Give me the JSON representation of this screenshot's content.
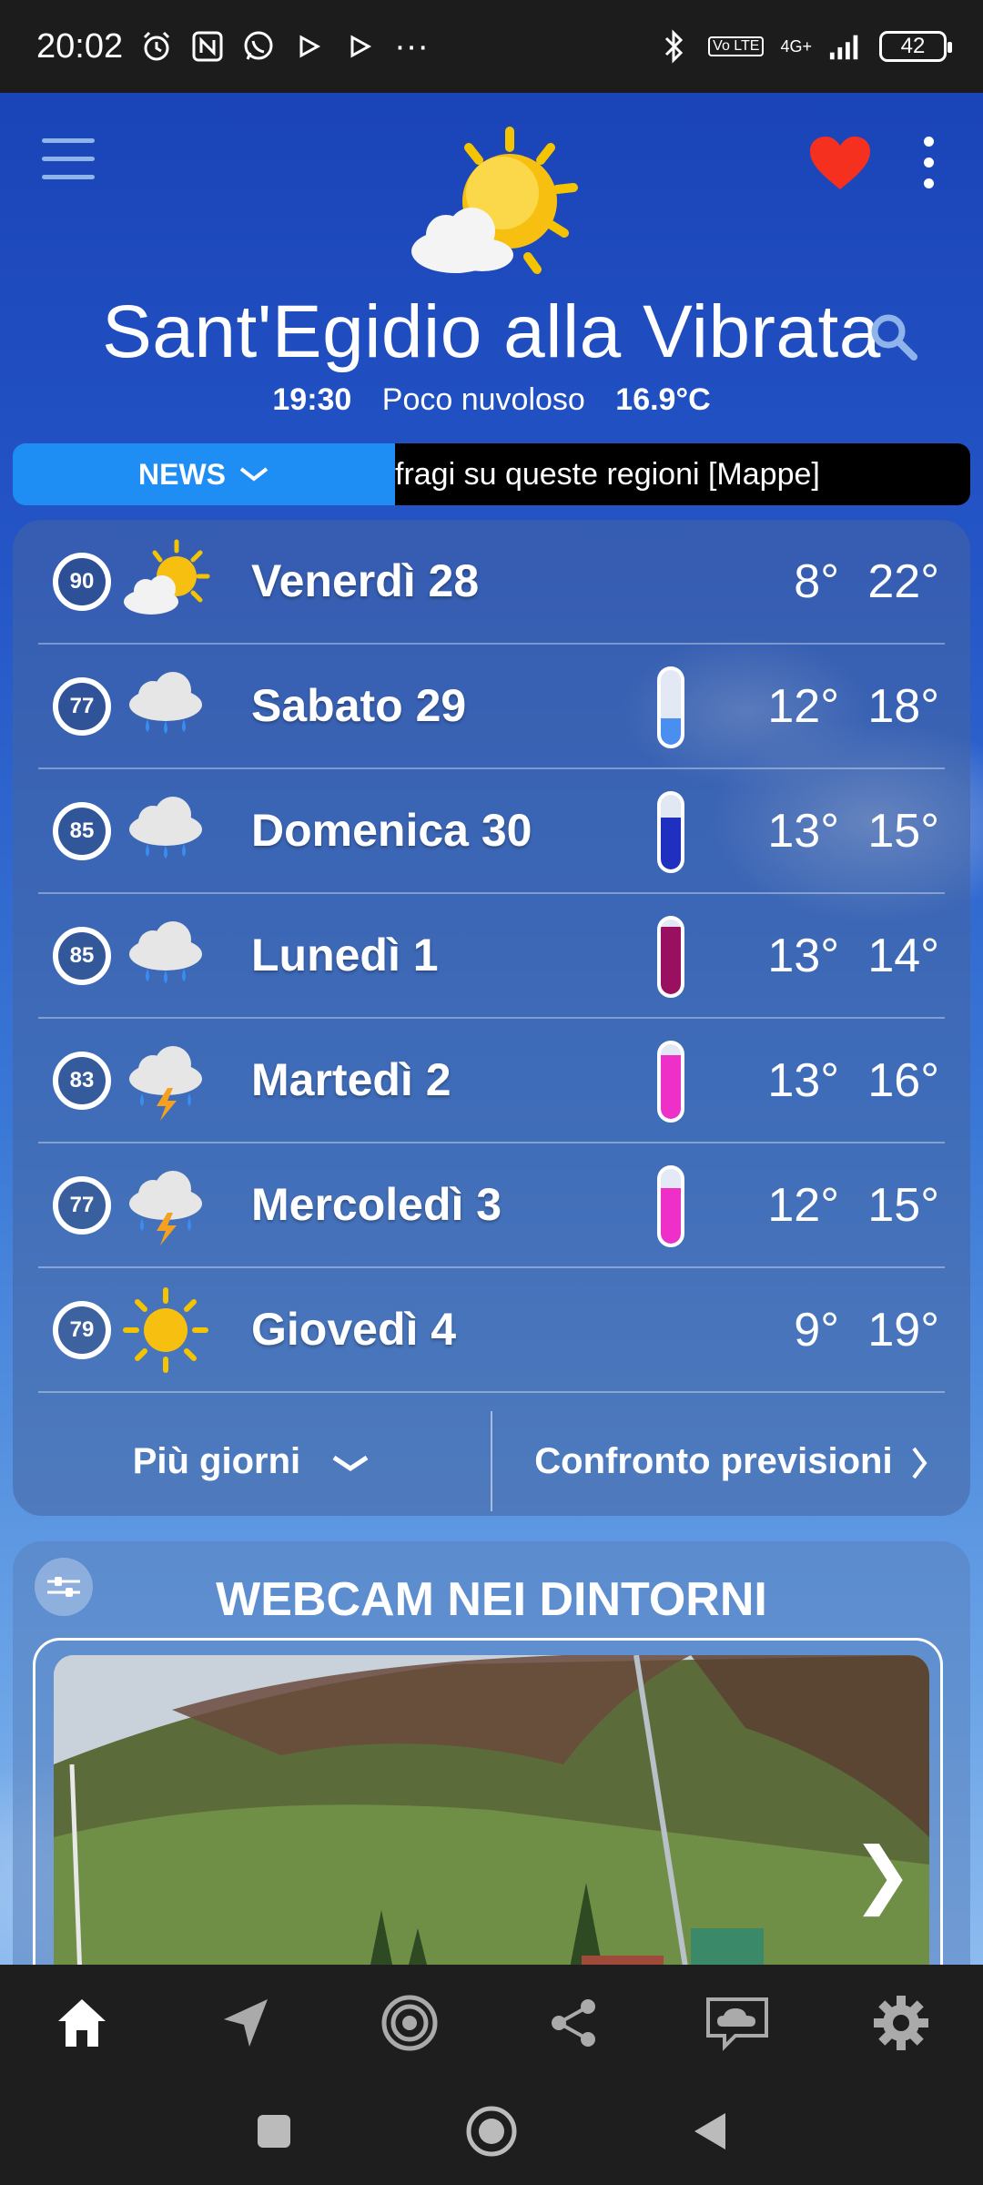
{
  "status_bar": {
    "time": "20:02",
    "network": "4G+",
    "volte": "Vo LTE",
    "battery": "42",
    "more": "···"
  },
  "header": {
    "city": "Sant'Egidio alla Vibrata",
    "current_time": "19:30",
    "current_condition": "Poco nuvoloso",
    "current_temp": "16.9°C"
  },
  "news": {
    "label": "NEWS",
    "ticker": "fragi su queste regioni [Mappe]"
  },
  "forecast": [
    {
      "reliability": "90",
      "day": "Venerdì 28",
      "min": "8°",
      "max": "22°",
      "icon": "sun-cloud",
      "rain_level": null
    },
    {
      "reliability": "77",
      "day": "Sabato 29",
      "min": "12°",
      "max": "18°",
      "icon": "rain-cloud",
      "rain_level": 0.35
    },
    {
      "reliability": "85",
      "day": "Domenica 30",
      "min": "13°",
      "max": "15°",
      "icon": "rain-cloud",
      "rain_level": 0.7
    },
    {
      "reliability": "85",
      "day": "Lunedì 1",
      "min": "13°",
      "max": "14°",
      "icon": "rain-cloud",
      "rain_level": 0.9
    },
    {
      "reliability": "83",
      "day": "Martedì 2",
      "min": "13°",
      "max": "16°",
      "icon": "storm-cloud",
      "rain_level": 0.85
    },
    {
      "reliability": "77",
      "day": "Mercoledì 3",
      "min": "12°",
      "max": "15°",
      "icon": "storm-cloud",
      "rain_level": 0.75
    },
    {
      "reliability": "79",
      "day": "Giovedì 4",
      "min": "9°",
      "max": "19°",
      "icon": "sun",
      "rain_level": null
    }
  ],
  "card_footer": {
    "more_days": "Più giorni",
    "compare": "Confronto previsioni"
  },
  "webcam": {
    "title": "WEBCAM NEI DINTORNI"
  },
  "colors": {
    "rain_light": "#4a8ff0",
    "rain_medium": "#1f2fbf",
    "rain_heavy": "#9a1060",
    "rain_storm": "#ee2fc8",
    "news_tag": "#1e8ef5"
  }
}
